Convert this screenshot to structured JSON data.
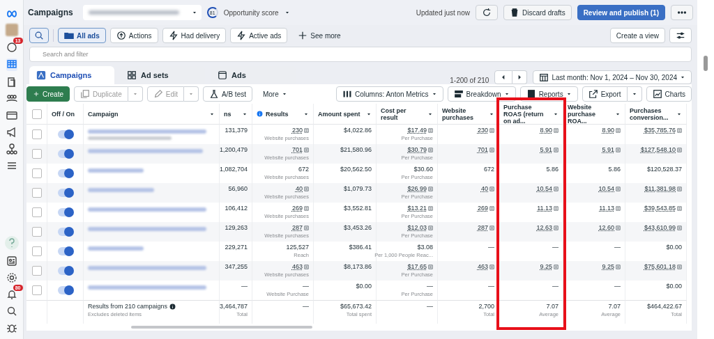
{
  "header": {
    "title": "Campaigns",
    "opportunity_score": "81",
    "opportunity_label": "Opportunity score",
    "updated": "Updated just now",
    "discard": "Discard drafts",
    "publish": "Review and publish (1)"
  },
  "sidebar": {
    "badges": [
      "13",
      "80"
    ]
  },
  "filters": [
    {
      "label": "All ads",
      "selected": true,
      "kind": "folder"
    },
    {
      "label": "Actions",
      "selected": false,
      "kind": "actions"
    },
    {
      "label": "Had delivery",
      "selected": false,
      "kind": "bolt"
    },
    {
      "label": "Active ads",
      "selected": false,
      "kind": "bolt"
    },
    {
      "label": "See more",
      "selected": false,
      "kind": "plus"
    }
  ],
  "create_view": "Create a view",
  "search": {
    "placeholder": "Search and filter"
  },
  "tabs": [
    {
      "label": "Campaigns",
      "selected": true,
      "kind": "campaigns"
    },
    {
      "label": "Ad sets",
      "selected": false,
      "kind": "adsets"
    },
    {
      "label": "Ads",
      "selected": false,
      "kind": "ads"
    }
  ],
  "pagination": "1-200 of 210",
  "date_range": "Last month: Nov 1, 2024 – Nov 30, 2024",
  "toolbar": {
    "create": "Create",
    "duplicate": "Duplicate",
    "edit": "Edit",
    "ab_test": "A/B test",
    "more": "More",
    "columns": "Columns: Anton Metrics",
    "breakdown": "Breakdown",
    "reports": "Reports",
    "export": "Export",
    "charts": "Charts"
  },
  "table": {
    "all_checked": false,
    "toggle_header": "Off / On",
    "name_header": "Campaign",
    "columns": [
      {
        "label": "ns",
        "highlighted": false
      },
      {
        "label": "Results",
        "highlighted": false
      },
      {
        "label": "Amount spent",
        "highlighted": false
      },
      {
        "label": "Cost per result",
        "highlighted": false
      },
      {
        "label": "Website purchases",
        "highlighted": false
      },
      {
        "label": "Purchase ROAS (return on ad...",
        "highlighted": true
      },
      {
        "label": "Website purchase ROA...",
        "highlighted": false
      },
      {
        "label": "Purchases conversion...",
        "highlighted": false
      }
    ],
    "rows": [
      {
        "on": true,
        "checked": false,
        "cells": [
          {
            "value": "131,379"
          },
          {
            "value": "230",
            "sub": "Website purchases",
            "linked": true
          },
          {
            "value": "$4,022.86"
          },
          {
            "value": "$17.49",
            "sub": "Per Purchase",
            "linked": true
          },
          {
            "value": "230",
            "linked": true
          },
          {
            "value": "8.90",
            "linked": true
          },
          {
            "value": "8.90",
            "linked": true
          },
          {
            "value": "$35,785.76",
            "linked": true
          }
        ]
      },
      {
        "on": true,
        "checked": false,
        "cells": [
          {
            "value": "1,200,479"
          },
          {
            "value": "701",
            "sub": "Website purchases",
            "linked": true
          },
          {
            "value": "$21,580.96"
          },
          {
            "value": "$30.79",
            "sub": "Per Purchase",
            "linked": true
          },
          {
            "value": "701",
            "linked": true
          },
          {
            "value": "5.91",
            "linked": true
          },
          {
            "value": "5.91",
            "linked": true
          },
          {
            "value": "$127,548.10",
            "linked": true
          }
        ]
      },
      {
        "on": true,
        "checked": false,
        "cells": [
          {
            "value": "1,082,704"
          },
          {
            "value": "672",
            "sub": "Website purchases",
            "linked": false
          },
          {
            "value": "$20,562.50"
          },
          {
            "value": "$30.60",
            "sub": "Per Purchase"
          },
          {
            "value": "672"
          },
          {
            "value": "5.86"
          },
          {
            "value": "5.86"
          },
          {
            "value": "$120,528.37"
          }
        ]
      },
      {
        "on": true,
        "checked": false,
        "cells": [
          {
            "value": "56,960"
          },
          {
            "value": "40",
            "sub": "Website purchases",
            "linked": true
          },
          {
            "value": "$1,079.73"
          },
          {
            "value": "$26.99",
            "sub": "Per Purchase",
            "linked": true
          },
          {
            "value": "40",
            "linked": true
          },
          {
            "value": "10.54",
            "linked": true
          },
          {
            "value": "10.54",
            "linked": true
          },
          {
            "value": "$11,381.98",
            "linked": true
          }
        ]
      },
      {
        "on": true,
        "checked": false,
        "cells": [
          {
            "value": "106,412"
          },
          {
            "value": "269",
            "sub": "Website purchases",
            "linked": true
          },
          {
            "value": "$3,552.81"
          },
          {
            "value": "$13.21",
            "sub": "Per Purchase",
            "linked": true
          },
          {
            "value": "269",
            "linked": true
          },
          {
            "value": "11.13",
            "linked": true
          },
          {
            "value": "11.13",
            "linked": true
          },
          {
            "value": "$39,543.85",
            "linked": true
          }
        ]
      },
      {
        "on": true,
        "checked": false,
        "cells": [
          {
            "value": "129,263"
          },
          {
            "value": "287",
            "sub": "Website purchases",
            "linked": true
          },
          {
            "value": "$3,453.26"
          },
          {
            "value": "$12.03",
            "sub": "Per Purchase",
            "linked": true
          },
          {
            "value": "287",
            "linked": true
          },
          {
            "value": "12.63",
            "linked": true
          },
          {
            "value": "12.60",
            "linked": true
          },
          {
            "value": "$43,610.99",
            "linked": true
          }
        ]
      },
      {
        "on": true,
        "checked": false,
        "cells": [
          {
            "value": "229,271"
          },
          {
            "value": "125,527",
            "sub": "Reach"
          },
          {
            "value": "$386.41"
          },
          {
            "value": "$3.08",
            "sub": "Per 1,000 People Reac..."
          },
          {
            "value": "—"
          },
          {
            "value": "—"
          },
          {
            "value": "—"
          },
          {
            "value": "$0.00"
          }
        ]
      },
      {
        "on": true,
        "checked": false,
        "cells": [
          {
            "value": "347,255"
          },
          {
            "value": "463",
            "sub": "Website purchases",
            "linked": true
          },
          {
            "value": "$8,173.86"
          },
          {
            "value": "$17.65",
            "sub": "Per Purchase",
            "linked": true
          },
          {
            "value": "463",
            "linked": true
          },
          {
            "value": "9.25",
            "linked": true
          },
          {
            "value": "9.25",
            "linked": true
          },
          {
            "value": "$75,601.18",
            "linked": true
          }
        ]
      },
      {
        "on": true,
        "checked": false,
        "cells": [
          {
            "value": "—"
          },
          {
            "value": "—",
            "sub": "Website Purchase"
          },
          {
            "value": "$0.00"
          },
          {
            "value": "—",
            "sub": "Per Purchase"
          },
          {
            "value": "—"
          },
          {
            "value": "—"
          },
          {
            "value": "—"
          },
          {
            "value": "$0.00"
          }
        ]
      }
    ],
    "footer": {
      "label": "Results from 210 campaigns",
      "note": "Excludes deleted items",
      "cells": [
        {
          "value": "3,464,787",
          "sub": "Total"
        },
        {
          "value": "—"
        },
        {
          "value": "$65,673.42",
          "sub": "Total spent"
        },
        {
          "value": "—"
        },
        {
          "value": "2,700",
          "sub": "Total"
        },
        {
          "value": "7.07",
          "sub": "Average"
        },
        {
          "value": "7.07",
          "sub": "Average"
        },
        {
          "value": "$464,422.67",
          "sub": "Total"
        }
      ]
    }
  }
}
